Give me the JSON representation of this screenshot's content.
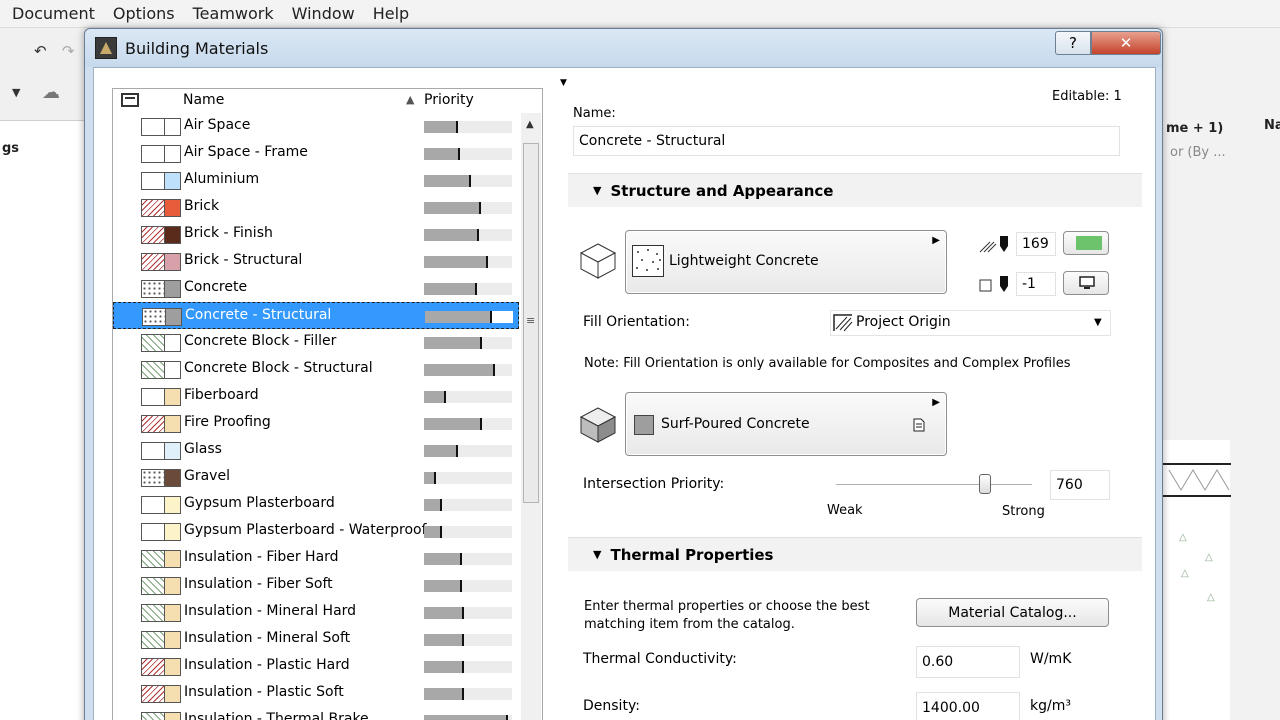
{
  "menubar": {
    "items": [
      "Document",
      "Options",
      "Teamwork",
      "Window",
      "Help"
    ]
  },
  "background": {
    "left_label": "gs",
    "right_label_1": "me + 1)",
    "right_label_2": "or (By ...",
    "right_tab": "Na"
  },
  "dialog": {
    "title": "Building Materials",
    "help_label": "?",
    "close_label": "✕"
  },
  "list": {
    "col_name": "Name",
    "col_priority": "Priority",
    "sort_indicator": "▲",
    "selected_index": 7,
    "items": [
      {
        "name": "Air Space",
        "priority": 0.4,
        "color": "#ffffff",
        "hatch": "none"
      },
      {
        "name": "Air Space - Frame",
        "priority": 0.42,
        "color": "#ffffff",
        "hatch": "none"
      },
      {
        "name": "Aluminium",
        "priority": 0.55,
        "color": "#bfe0fb",
        "hatch": "none"
      },
      {
        "name": "Brick",
        "priority": 0.66,
        "color": "#e85c3c",
        "hatch": "diag"
      },
      {
        "name": "Brick - Finish",
        "priority": 0.64,
        "color": "#5a2a1a",
        "hatch": "diag"
      },
      {
        "name": "Brick - Structural",
        "priority": 0.74,
        "color": "#d8a0a8",
        "hatch": "diag"
      },
      {
        "name": "Concrete",
        "priority": 0.62,
        "color": "#9e9e9e",
        "hatch": "dots"
      },
      {
        "name": "Concrete - Structural",
        "priority": 0.78,
        "color": "#9e9e9e",
        "hatch": "dots"
      },
      {
        "name": "Concrete Block - Filler",
        "priority": 0.68,
        "color": "#ffffff",
        "hatch": "cross"
      },
      {
        "name": "Concrete Block - Structural",
        "priority": 0.82,
        "color": "#ffffff",
        "hatch": "cross"
      },
      {
        "name": "Fiberboard",
        "priority": 0.25,
        "color": "#f5deb0",
        "hatch": "none"
      },
      {
        "name": "Fire Proofing",
        "priority": 0.68,
        "color": "#f5deb0",
        "hatch": "diag"
      },
      {
        "name": "Glass",
        "priority": 0.4,
        "color": "#e0f0fb",
        "hatch": "none"
      },
      {
        "name": "Gravel",
        "priority": 0.14,
        "color": "#6a4a38",
        "hatch": "dots"
      },
      {
        "name": "Gypsum Plasterboard",
        "priority": 0.21,
        "color": "#fcf3c8",
        "hatch": "none"
      },
      {
        "name": "Gypsum Plasterboard - Waterproof",
        "priority": 0.21,
        "color": "#fcf3c8",
        "hatch": "none"
      },
      {
        "name": "Insulation - Fiber Hard",
        "priority": 0.44,
        "color": "#f5deb0",
        "hatch": "cross"
      },
      {
        "name": "Insulation - Fiber Soft",
        "priority": 0.44,
        "color": "#f5deb0",
        "hatch": "cross"
      },
      {
        "name": "Insulation - Mineral Hard",
        "priority": 0.46,
        "color": "#f5deb0",
        "hatch": "cross"
      },
      {
        "name": "Insulation - Mineral Soft",
        "priority": 0.46,
        "color": "#f5deb0",
        "hatch": "cross"
      },
      {
        "name": "Insulation - Plastic Hard",
        "priority": 0.46,
        "color": "#f5deb0",
        "hatch": "diag"
      },
      {
        "name": "Insulation - Plastic Soft",
        "priority": 0.46,
        "color": "#f5deb0",
        "hatch": "diag"
      },
      {
        "name": "Insulation - Thermal Brake",
        "priority": 0.98,
        "color": "#f5deb0",
        "hatch": "cross"
      }
    ]
  },
  "details": {
    "editable_label": "Editable: 1",
    "name_label": "Name:",
    "name_value": "Concrete - Structural",
    "structure_section": "Structure and Appearance",
    "fill_name": "Lightweight Concrete",
    "pen_fg_value": "169",
    "pen_bg_value": "-1",
    "fill_orientation_label": "Fill Orientation:",
    "fill_orientation_value": "Project Origin",
    "fill_orientation_note": "Note: Fill Orientation is only available for Composites and Complex Profiles",
    "surface_name": "Surf-Poured Concrete",
    "intersection_priority_label": "Intersection Priority:",
    "intersection_priority_value": "760",
    "priority_fraction": 0.76,
    "slider_weak": "Weak",
    "slider_strong": "Strong",
    "thermal_section": "Thermal Properties",
    "thermal_note_1": "Enter thermal properties or choose the best",
    "thermal_note_2": "matching item from the catalog.",
    "material_catalog_button": "Material Catalog...",
    "thermal_conductivity_label": "Thermal Conductivity:",
    "thermal_conductivity_value": "0.60",
    "thermal_conductivity_unit": "W/mK",
    "density_label": "Density:",
    "density_value": "1400.00",
    "density_unit": "kg/m³"
  },
  "colors": {
    "selection": "#3399ff",
    "pen_fg_swatch": "#6cc36c"
  }
}
